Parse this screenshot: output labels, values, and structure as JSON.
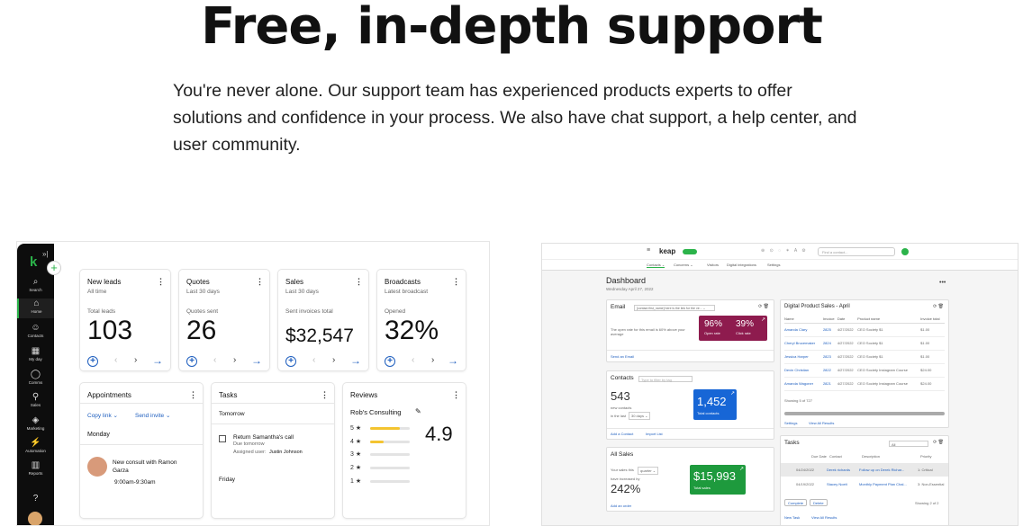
{
  "hero": {
    "title": "Free, in-depth support",
    "description": "You're never alone. Our support team has experienced products experts to offer solutions and confidence in your process. We also have chat support, a help center, and user community."
  },
  "left_app": {
    "sidebar": {
      "logo": "k",
      "collapse": "»|",
      "plus": "+",
      "items": [
        {
          "icon": "⌕",
          "label": "Search"
        },
        {
          "icon": "⌂",
          "label": "Home"
        },
        {
          "icon": "☺",
          "label": "Contacts"
        },
        {
          "icon": "▦",
          "label": "My day"
        },
        {
          "icon": "◯",
          "label": "Comms"
        },
        {
          "icon": "⚲",
          "label": "Sales"
        },
        {
          "icon": "◈",
          "label": "Marketing"
        },
        {
          "icon": "⚡",
          "label": "Automation"
        },
        {
          "icon": "▥",
          "label": "Reports"
        },
        {
          "icon": "?",
          "label": ""
        }
      ]
    },
    "metrics": [
      {
        "title": "New leads",
        "period": "All time",
        "label": "Total leads",
        "value": "103"
      },
      {
        "title": "Quotes",
        "period": "Last 30 days",
        "label": "Quotes sent",
        "value": "26"
      },
      {
        "title": "Sales",
        "period": "Last 30 days",
        "label": "Sent invoices total",
        "value": "$32,547"
      },
      {
        "title": "Broadcasts",
        "period": "Latest broadcast",
        "label": "Opened",
        "value": "32%"
      }
    ],
    "nav_glyphs": {
      "add": "+",
      "prev": "‹",
      "next": "›",
      "arrow": "→",
      "kebab": "⋮"
    },
    "appointments": {
      "title": "Appointments",
      "copy_link": "Copy link ⌄",
      "send_invite": "Send invite ⌄",
      "day": "Monday",
      "item_title": "New consult with Ramon Garza",
      "item_time": "9:00am-9:30am"
    },
    "tasks": {
      "title": "Tasks",
      "day1": "Tomorrow",
      "task": "Return Samantha's call",
      "due": "Due tomorrow",
      "assigned_label": "Assigned user:",
      "assigned_user": "Justin Johnson",
      "day2": "Friday"
    },
    "reviews": {
      "title": "Reviews",
      "business": "Rob's Consulting",
      "edit_icon": "✎",
      "rating": "4.9",
      "rows": [
        {
          "label": "5 ★",
          "fill": 0.75
        },
        {
          "label": "4 ★",
          "fill": 0.35
        },
        {
          "label": "3 ★",
          "fill": 0
        },
        {
          "label": "2 ★",
          "fill": 0
        },
        {
          "label": "1 ★",
          "fill": 0
        }
      ]
    }
  },
  "right_app": {
    "logo": "keap",
    "topbar_icons": "⊕ ⊙ ◌ ✶ A ⚙",
    "search_placeholder": "Find a contact...",
    "tabs": [
      "Contacts ⌄",
      "Concerns ⌄",
      "Visitors",
      "Digital integrations",
      "Settings"
    ],
    "dashboard_title": "Dashboard",
    "dashboard_date": "Wednesday April 27, 2022",
    "more": "•••",
    "email": {
      "title": "Email",
      "select": "[contact.first_name] here is the link for the ve... ⌄",
      "desc": "The open rate for this email is 60% above your average",
      "open_rate": "96%",
      "open_label": "Open rate",
      "click_rate": "39%",
      "click_label": "Click rate",
      "link": "Send an Email"
    },
    "contacts": {
      "title": "Contacts",
      "filter_placeholder": "Type to filter by tag",
      "value": "543",
      "new_label": "new contacts",
      "in_last": "in the last",
      "days": "30 days ⌄",
      "total": "1,452",
      "total_label": "Total contacts",
      "add": "Add a Contact",
      "import": "Import List"
    },
    "sales": {
      "title": "All Sales",
      "filter_label": "Your sales this",
      "filter_value": "quarter ⌄",
      "increase_label": "have increased by",
      "percent": "242%",
      "amount": "$15,993",
      "amount_label": "Total sales",
      "link": "Add an order"
    },
    "digital": {
      "title": "Digital Product Sales - April",
      "columns": [
        "Name",
        "Invoice",
        "Date",
        "Product name",
        "Invoice total"
      ],
      "rows": [
        [
          "Amanda Clary",
          "2825",
          "4/27/2022",
          "CEO Society $1",
          "$1.00"
        ],
        [
          "Cheryl Brucemaker",
          "2824",
          "4/27/2022",
          "CEO Society $1",
          "$1.00"
        ],
        [
          "Jessica Harper",
          "2823",
          "4/27/2022",
          "CEO Society $1",
          "$1.00"
        ],
        [
          "Devin Christian",
          "2822",
          "4/27/2022",
          "CEO Society Instagram Course",
          "$24.00"
        ],
        [
          "Amanda Wagoner",
          "2821",
          "4/27/2022",
          "CEO Society Instagram Course",
          "$24.00"
        ]
      ],
      "showing": "Showing 5 of 727",
      "settings": "Settings",
      "view_all": "View All Results"
    },
    "tasks": {
      "title": "Tasks",
      "filter": "All",
      "columns": [
        "Due Date",
        "Contact",
        "Description",
        "Priority"
      ],
      "rows": [
        [
          "04/24/2022",
          "Derek richards",
          "Follow up on Derek Richar...",
          "1: Critical"
        ],
        [
          "04/19/2022",
          "Stacey Noelt",
          "Monthly Payment Plan Chal...",
          "3: Non-Essential"
        ]
      ],
      "complete": "Complete",
      "delete": "Delete",
      "showing": "Showing 2 of 2",
      "new_task": "New Task",
      "view_all": "View All Results"
    },
    "colors": {
      "green": "#2bb34a",
      "burgundy": "#8e1b4e",
      "blue": "#1766d6",
      "sales_green": "#1e9a3d"
    }
  }
}
